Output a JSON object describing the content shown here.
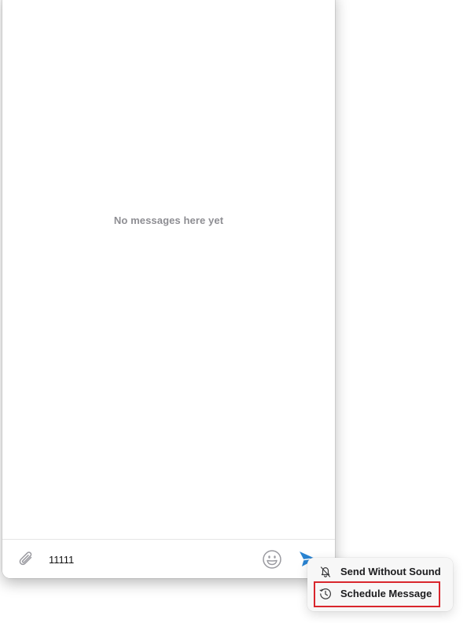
{
  "chat": {
    "empty_state": "No messages here yet"
  },
  "composer": {
    "input_value": "11111",
    "icons": {
      "attach": "paperclip-icon",
      "emoji": "smiley-icon",
      "send": "paper-plane-icon"
    }
  },
  "send_menu": {
    "items": [
      {
        "label": "Send Without Sound",
        "icon": "bell-slash-icon"
      },
      {
        "label": "Schedule Message",
        "icon": "clock-icon"
      }
    ]
  },
  "colors": {
    "accent": "#2a84d2",
    "highlight": "#d9262c",
    "muted_text": "#8e8e93"
  }
}
